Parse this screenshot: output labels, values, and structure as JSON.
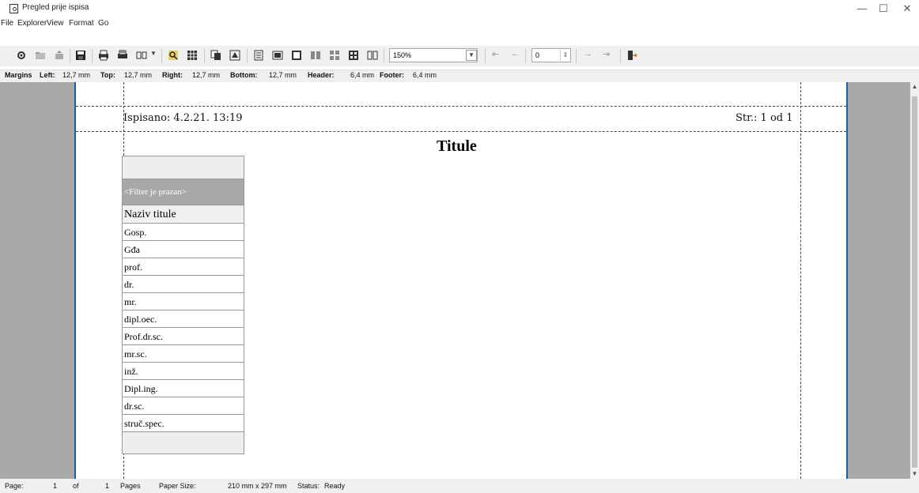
{
  "window": {
    "title": "Pregled prije ispisa",
    "minimize": "—",
    "maximize": "☐",
    "close": "✕"
  },
  "menu": [
    "File",
    "Explorer",
    "View",
    "Format",
    "Go"
  ],
  "toolbar": {
    "zoom_value": "150%",
    "page_number": "0"
  },
  "margins": {
    "label": "Margins",
    "left_label": "Left:",
    "left": "12,7 mm",
    "top_label": "Top:",
    "top": "12,7 mm",
    "right_label": "Right:",
    "right": "12,7 mm",
    "bottom_label": "Bottom:",
    "bottom": "12,7 mm",
    "header_label": "Header:",
    "header": "6,4 mm",
    "footer_label": "Footer:",
    "footer": "6,4 mm"
  },
  "report": {
    "printed_at": "Ispisano: 4.2.21. 13:19",
    "page_info": "Str.: 1 od 1",
    "title": "Titule",
    "filter_text": "<Filter je prazan>",
    "column_header": "Naziv titule",
    "rows": [
      "Gosp.",
      "Gđa",
      "prof.",
      "dr.",
      "mr.",
      "dipl.oec.",
      "Prof.dr.sc.",
      "mr.sc.",
      "inž.",
      "Dipl.ing.",
      "dr.sc.",
      "struč.spec."
    ]
  },
  "status": {
    "page_label": "Page:",
    "page": "1",
    "of_label": "of",
    "pages": "1",
    "pages_label": "Pages",
    "paper_label": "Paper Size:",
    "paper": "210 mm x 297 mm",
    "status_label": "Status:",
    "status": "Ready"
  }
}
